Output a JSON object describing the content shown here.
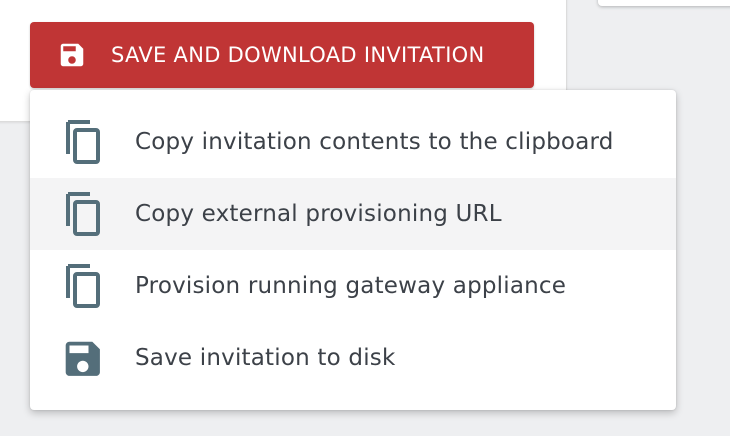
{
  "button": {
    "label": "SAVE AND DOWNLOAD INVITATION",
    "icon": "floppy-disk-icon",
    "color": "#c03535"
  },
  "menu": {
    "items": [
      {
        "label": "Copy invitation contents to the clipboard",
        "icon": "copy-icon"
      },
      {
        "label": "Copy external provisioning URL",
        "icon": "copy-icon"
      },
      {
        "label": "Provision running gateway appliance",
        "icon": "copy-icon"
      },
      {
        "label": "Save invitation to disk",
        "icon": "floppy-disk-icon"
      }
    ],
    "icon_color": "#546e7a",
    "text_color": "#3c4148"
  }
}
